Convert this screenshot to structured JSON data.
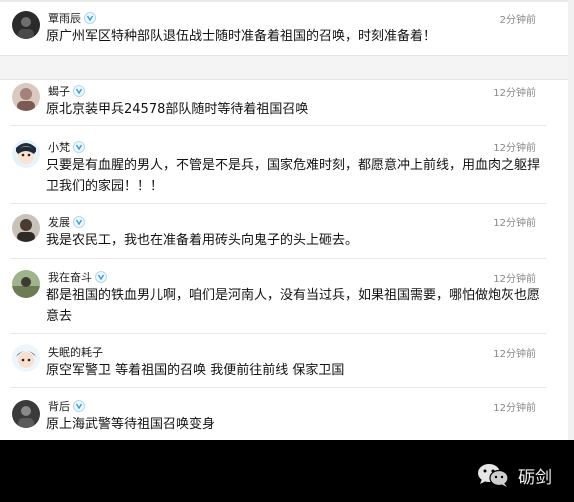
{
  "comments": [
    {
      "user": "覃雨辰",
      "time": "2分钟前",
      "text": "原广州军区特种部队退伍战士随时准备着祖国的召唤，时刻准备着！",
      "avatar": "avatar-dark-photo"
    },
    {
      "user": "蝎子",
      "time": "12分钟前",
      "text": "原北京装甲兵24578部队随时等待着祖国召唤",
      "avatar": "avatar-person-photo"
    },
    {
      "user": "小梵",
      "time": "12分钟前",
      "text": "只要是有血腥的男人，不管是不是兵，国家危难时刻，都愿意冲上前线，用血肉之躯捍卫我们的家园！！！",
      "avatar": "avatar-cartoon"
    },
    {
      "user": "发展",
      "time": "12分钟前",
      "text": "我是农民工，我也在准备着用砖头向鬼子的头上砸去。",
      "avatar": "avatar-person-photo"
    },
    {
      "user": "我在奋斗",
      "time": "12分钟前",
      "text": "都是祖国的铁血男儿啊，咱们是河南人，没有当过兵，如果祖国需要，哪怕做炮灰也愿意去",
      "avatar": "avatar-outdoor-photo"
    },
    {
      "user": "失眠的耗子",
      "time": "12分钟前",
      "text": "原空军警卫  等着祖国的召唤  我便前往前线  保家卫国",
      "avatar": "avatar-cartoon"
    },
    {
      "user": "背后",
      "time": "12分钟前",
      "text": "原上海武警等待祖国召唤变身",
      "avatar": "avatar-dark-photo"
    }
  ],
  "footer": {
    "brand": "砺剑",
    "icon": "wechat-icon"
  },
  "colors": {
    "bar": "#000000",
    "verified": "#3a9fd6"
  }
}
